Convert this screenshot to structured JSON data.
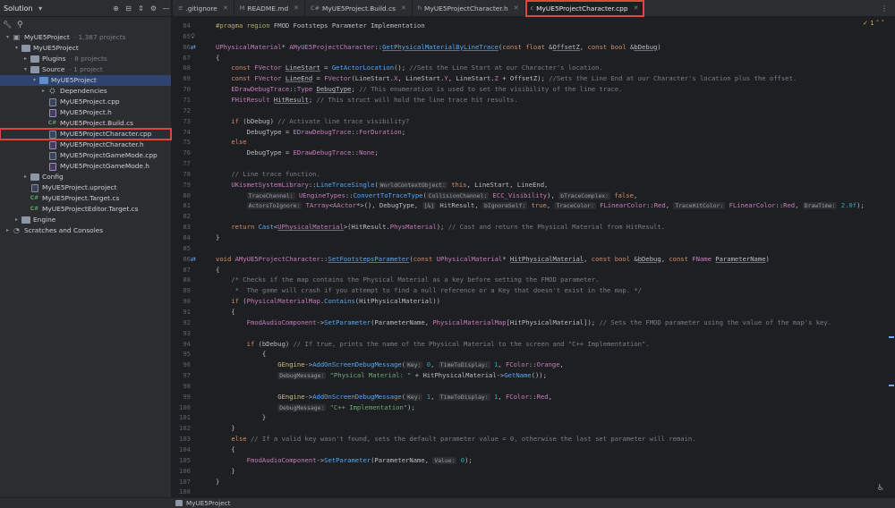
{
  "sidebar": {
    "title": "Solution",
    "tree": [
      {
        "label": "MyUE5Project",
        "meta": "· 1,387 projects",
        "depth": 0,
        "arrow": "v",
        "icon": "solution"
      },
      {
        "label": "MyUE5Project",
        "meta": "",
        "depth": 1,
        "arrow": "v",
        "icon": "folder"
      },
      {
        "label": "Plugins",
        "meta": "· 8 projects",
        "depth": 2,
        "arrow": ">",
        "icon": "folder"
      },
      {
        "label": "Source",
        "meta": "· 1 project",
        "depth": 2,
        "arrow": "v",
        "icon": "folder"
      },
      {
        "label": "MyUE5Project",
        "meta": "",
        "depth": 3,
        "arrow": "v",
        "icon": "folder-blue",
        "selected": true
      },
      {
        "label": "Dependencies",
        "meta": "",
        "depth": 4,
        "arrow": ">",
        "icon": "deps"
      },
      {
        "label": "MyUE5Project.cpp",
        "meta": "",
        "depth": 4,
        "arrow": "",
        "icon": "cpp"
      },
      {
        "label": "MyUE5Project.h",
        "meta": "",
        "depth": 4,
        "arrow": "",
        "icon": "h"
      },
      {
        "label": "MyUE5Project.Build.cs",
        "meta": "",
        "depth": 4,
        "arrow": "",
        "icon": "cs"
      },
      {
        "label": "MyUE5ProjectCharacter.cpp",
        "meta": "",
        "depth": 4,
        "arrow": "",
        "icon": "cpp",
        "boxed": true
      },
      {
        "label": "MyUE5ProjectCharacter.h",
        "meta": "",
        "depth": 4,
        "arrow": "",
        "icon": "h"
      },
      {
        "label": "MyUE5ProjectGameMode.cpp",
        "meta": "",
        "depth": 4,
        "arrow": "",
        "icon": "cpp"
      },
      {
        "label": "MyUE5ProjectGameMode.h",
        "meta": "",
        "depth": 4,
        "arrow": "",
        "icon": "h"
      },
      {
        "label": "Config",
        "meta": "",
        "depth": 2,
        "arrow": ">",
        "icon": "folder"
      },
      {
        "label": "MyUE5Project.uproject",
        "meta": "",
        "depth": 2,
        "arrow": "",
        "icon": "cpp"
      },
      {
        "label": "MyUE5Project.Target.cs",
        "meta": "",
        "depth": 2,
        "arrow": "",
        "icon": "cs"
      },
      {
        "label": "MyUE5ProjectEditor.Target.cs",
        "meta": "",
        "depth": 2,
        "arrow": "",
        "icon": "cs"
      },
      {
        "label": "Engine",
        "meta": "",
        "depth": 1,
        "arrow": ">",
        "icon": "folder"
      },
      {
        "label": "Scratches and Consoles",
        "meta": "",
        "depth": 0,
        "arrow": ">",
        "icon": "scratch"
      }
    ]
  },
  "tabs": [
    {
      "label": ".gitignore",
      "icon": "≡"
    },
    {
      "label": "README.md",
      "icon": "M"
    },
    {
      "label": "MyUE5Project.Build.cs",
      "icon": "C#"
    },
    {
      "label": "MyUE5ProjectCharacter.h",
      "icon": "h"
    },
    {
      "label": "MyUE5ProjectCharacter.cpp",
      "icon": "c",
      "active": true
    }
  ],
  "editor": {
    "warning_count": "1",
    "lines": [
      {
        "n": "64",
        "html": "<span class='pp'>#pragma region</span> FMOD Footsteps Parameter Implementation"
      },
      {
        "n": "65",
        "html": ""
      },
      {
        "n": "66",
        "mark": "⇄",
        "html": "<span class='ty'>UPhysicalMaterial</span>* <span class='ty'>AMyUE5ProjectCharacter</span>::<span class='fn und'>GetPhysicalMaterialByLineTrace</span>(<span class='kw'>const float</span> &amp;<span class='und'>OffsetZ</span>, <span class='kw'>const bool</span> &amp;<span class='und'>bDebug</span>)"
      },
      {
        "n": "67",
        "html": "{"
      },
      {
        "n": "68",
        "html": "    <span class='kw'>const</span> <span class='ty'>FVector</span> <span class='und'>LineStart</span> = <span class='fn'>GetActorLocation</span>(); <span class='cm'>//Sets the Line Start at our Character's location.</span>"
      },
      {
        "n": "69",
        "html": "    <span class='kw'>const</span> <span class='ty'>FVector</span> <span class='und'>LineEnd</span> = <span class='ty'>FVector</span>(LineStart.<span class='mb'>X</span>, LineStart.<span class='mb'>Y</span>, LineStart.<span class='mb'>Z</span> + OffsetZ); <span class='cm'>//Sets the Line End at our Character's location plus the offset.</span>"
      },
      {
        "n": "70",
        "html": "    <span class='ty'>EDrawDebugTrace</span>::<span class='ty'>Type</span> <span class='und'>DebugType</span>; <span class='cm'>// This enumeration is used to set the visibility of the line trace.</span>"
      },
      {
        "n": "71",
        "html": "    <span class='ty'>FHitResult</span> <span class='und'>HitResult</span>; <span class='cm'>// This struct will hold the line trace hit results.</span>"
      },
      {
        "n": "72",
        "html": ""
      },
      {
        "n": "73",
        "html": "    <span class='kw'>if</span> (bDebug) <span class='cm'>// Activate line trace visibility?</span>"
      },
      {
        "n": "74",
        "html": "        DebugType = <span class='ty'>EDrawDebugTrace</span>::<span class='mb'>ForDuration</span>;"
      },
      {
        "n": "75",
        "html": "    <span class='kw'>else</span>"
      },
      {
        "n": "76",
        "html": "        DebugType = <span class='ty'>EDrawDebugTrace</span>::<span class='mb'>None</span>;"
      },
      {
        "n": "77",
        "html": ""
      },
      {
        "n": "78",
        "html": "    <span class='cm'>// Line trace function.</span>"
      },
      {
        "n": "79",
        "html": "    <span class='ty'>UKismetSystemLibrary</span>::<span class='fn'>LineTraceSingle</span>(<span class='ph'>WorldContextObject:</span> <span class='kw'>this</span>, LineStart, LineEnd,"
      },
      {
        "n": "80",
        "html": "        <span class='ph'>TraceChannel:</span> <span class='ty'>UEngineTypes</span>::<span class='fn'>ConvertToTraceType</span>(<span class='ph'>CollisionChannel:</span> <span class='mb'>ECC_Visibility</span>), <span class='ph'>bTraceComplex:</span> <span class='kw'>false</span>,"
      },
      {
        "n": "81",
        "html": "        <span class='ph'>ActorsToIgnore:</span> <span class='ty'>TArray</span>&lt;<span class='ty'>AActor</span>*&gt;(), DebugType, <span class='ph'>[&amp;]</span> HitResult, <span class='ph'>bIgnoreSelf:</span> <span class='kw'>true</span>, <span class='ph'>TraceColor:</span> <span class='ty'>FLinearColor</span>::<span class='mb'>Red</span>, <span class='ph'>TraceHitColor:</span> <span class='ty'>FLinearColor</span>::<span class='mb'>Red</span>, <span class='ph'>DrawTime:</span> <span class='num'>2.0f</span>);"
      },
      {
        "n": "82",
        "html": ""
      },
      {
        "n": "83",
        "html": "    <span class='kw'>return</span> <span class='fn'>Cast</span>&lt;<span class='ty und'>UPhysicalMaterial</span>&gt;(HitResult.<span class='mb'>PhysMaterial</span>); <span class='cm'>// Cast and return the Physical Material from HitResult.</span>"
      },
      {
        "n": "84",
        "html": "}"
      },
      {
        "n": "85",
        "html": ""
      },
      {
        "n": "86",
        "mark": "⇄",
        "html": "<span class='kw'>void</span> <span class='ty'>AMyUE5ProjectCharacter</span>::<span class='fn und'>SetFootstepsParameter</span>(<span class='kw'>const</span> <span class='ty'>UPhysicalMaterial</span>* <span class='und'>HitPhysicalMaterial</span>, <span class='kw'>const bool</span> &amp;<span class='und'>bDebug</span>, <span class='kw'>const</span> <span class='ty'>FName</span> <span class='und'>ParameterName</span>)"
      },
      {
        "n": "87",
        "html": "{"
      },
      {
        "n": "88",
        "html": "    <span class='cm'>/* Checks if the map contains the Physical Material as a key before setting the FMOD parameter.</span>"
      },
      {
        "n": "89",
        "html": "    <span class='cm'> *  The game will crash if you attempt to find a null reference or a Key that doesn't exist in the map. */</span>"
      },
      {
        "n": "90",
        "html": "    <span class='kw'>if</span> (<span class='mb'>PhysicalMaterialMap</span>.<span class='fn'>Contains</span>(HitPhysicalMaterial))"
      },
      {
        "n": "91",
        "html": "    {"
      },
      {
        "n": "92",
        "html": "        <span class='mb'>FmodAudioComponent</span>-&gt;<span class='fn'>SetParameter</span>(ParameterName, <span class='mb'>PhysicalMaterialMap</span>[HitPhysicalMaterial]); <span class='cm'>// Sets the FMOD parameter using the value of the map's key.</span>"
      },
      {
        "n": "93",
        "html": ""
      },
      {
        "n": "94",
        "html": "        <span class='kw'>if</span> (bDebug) <span class='cm'>// If true, prints the name of the Physical Material to the screen and \"C++ Implementation\".</span>"
      },
      {
        "n": "95",
        "html": "            {"
      },
      {
        "n": "96",
        "html": "                <span class='mac'>GEngine</span>-&gt;<span class='fn'>AddOnScreenDebugMessage</span>(<span class='ph'>Key:</span> <span class='num'>0</span>, <span class='ph'>TimeToDisplay:</span> <span class='num'>1</span>, <span class='ty'>FColor</span>::<span class='mb'>Orange</span>,"
      },
      {
        "n": "97",
        "html": "                <span class='ph'>DebugMessage:</span> <span class='str'>\"Physical Material: \"</span> + HitPhysicalMaterial-&gt;<span class='fn'>GetName</span>());"
      },
      {
        "n": "98",
        "html": ""
      },
      {
        "n": "99",
        "html": "                <span class='mac'>GEngine</span>-&gt;<span class='fn'>AddOnScreenDebugMessage</span>(<span class='ph'>Key:</span> <span class='num'>1</span>, <span class='ph'>TimeToDisplay:</span> <span class='num'>1</span>, <span class='ty'>FColor</span>::<span class='mb'>Red</span>,"
      },
      {
        "n": "100",
        "html": "                <span class='ph'>DebugMessage:</span> <span class='str'>\"C++ Implementation\"</span>);"
      },
      {
        "n": "101",
        "html": "            }"
      },
      {
        "n": "102",
        "html": "    }"
      },
      {
        "n": "103",
        "html": "    <span class='kw'>else</span> <span class='cm'>// If a valid key wasn't found, sets the default parameter value = 0, otherwise the last set parameter will remain.</span>"
      },
      {
        "n": "104",
        "html": "    {"
      },
      {
        "n": "105",
        "html": "        <span class='mb'>FmodAudioComponent</span>-&gt;<span class='fn'>SetParameter</span>(ParameterName, <span class='ph'>Value:</span> <span class='num'>0</span>);"
      },
      {
        "n": "106",
        "html": "    }"
      },
      {
        "n": "107",
        "html": "}"
      },
      {
        "n": "108",
        "html": ""
      }
    ]
  },
  "status": {
    "breadcrumb": "MyUE5Project"
  },
  "colors": {
    "accent": "#e0473b",
    "selection": "#2e436e",
    "background": "#1e1f22",
    "panel": "#2b2d30"
  }
}
